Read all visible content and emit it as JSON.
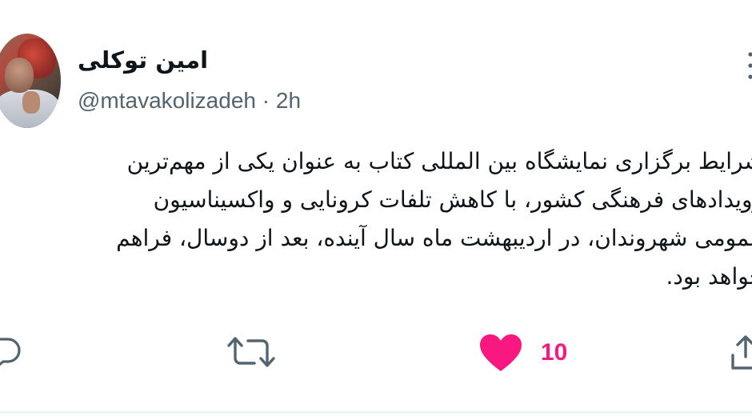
{
  "tweet": {
    "author": {
      "display_name": "امین توکلی",
      "handle": "@mtavakolizadeh",
      "separator": " · ",
      "time": "2h",
      "avatar_icon": "profile-photo"
    },
    "text_lines": [
      "شرایط برگزاری نمایشگاه بین المللی کتاب به عنوان یکی از مهم‌ترین",
      "رویدادهای فرهنگی کشور، با کاهش تلفات کرونایی و واکسیناسیون",
      "عمومی شهروندان،  در اردیبهشت ماه سال آینده، بعد از دوسال، فراهم",
      "خواهد بود."
    ],
    "actions": {
      "reply_icon": "reply-icon",
      "retweet_icon": "retweet-icon",
      "like_icon": "heart-icon",
      "like_count": "10",
      "share_icon": "share-icon",
      "liked": true
    },
    "colors": {
      "text": "#0f1419",
      "secondary": "#536471",
      "like": "#f91880"
    }
  }
}
